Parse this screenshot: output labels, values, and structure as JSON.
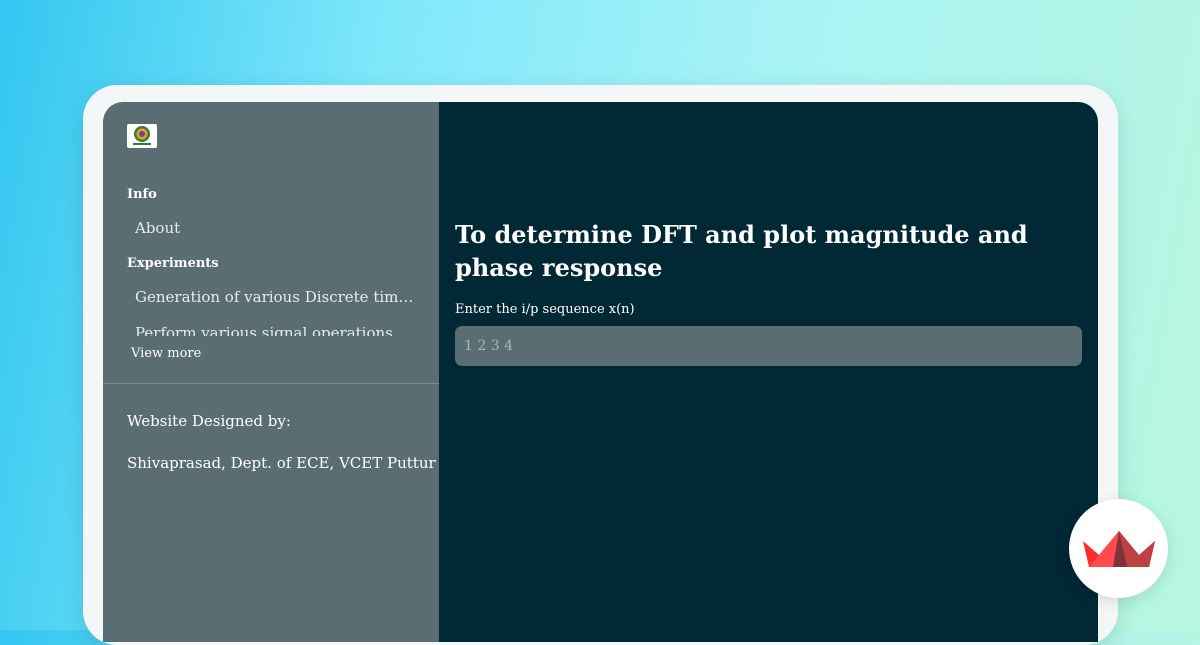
{
  "sidebar": {
    "logo_icon": "college-logo-icon",
    "sections": [
      {
        "heading": "Info",
        "items": [
          "About"
        ]
      },
      {
        "heading": "Experiments",
        "items": [
          "Generation of various Discrete time signals",
          "Perform various signal operations"
        ]
      }
    ],
    "view_more": "View more",
    "credit_line1": "Website Designed by:",
    "credit_line2": "Shivaprasad, Dept. of ECE, VCET Puttur"
  },
  "main": {
    "title": "To determine DFT and plot magnitude and phase response",
    "input_label": "Enter the i/p sequence x(n)",
    "input_placeholder": "1 2 3 4"
  },
  "badge": {
    "icon": "streamlit-crown-icon"
  },
  "colors": {
    "sidebar_bg": "#596d73",
    "main_bg": "#012835",
    "input_bg": "#596d73",
    "accent_red": "#ff2b2b"
  }
}
